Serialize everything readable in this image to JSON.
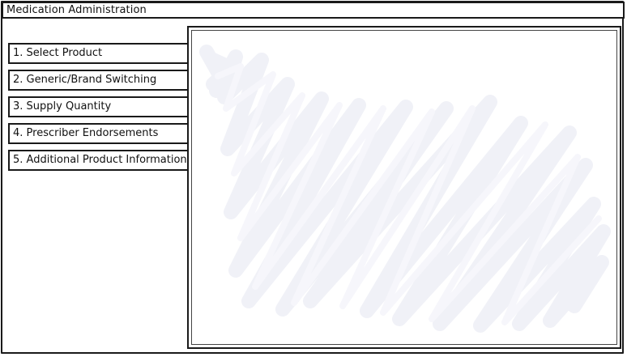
{
  "window": {
    "title": "Medication Administration"
  },
  "sidebar": {
    "items": [
      {
        "label": "1. Select Product"
      },
      {
        "label": "2. Generic/Brand Switching"
      },
      {
        "label": "3. Supply Quantity"
      },
      {
        "label": "4. Prescriber Endorsements"
      },
      {
        "label": "5. Additional Product Information"
      }
    ]
  },
  "content": {
    "placeholder": "scribble-placeholder"
  },
  "colors": {
    "border": "#1a1a1a",
    "scribble": "#f1f2f8",
    "background": "#ffffff"
  }
}
